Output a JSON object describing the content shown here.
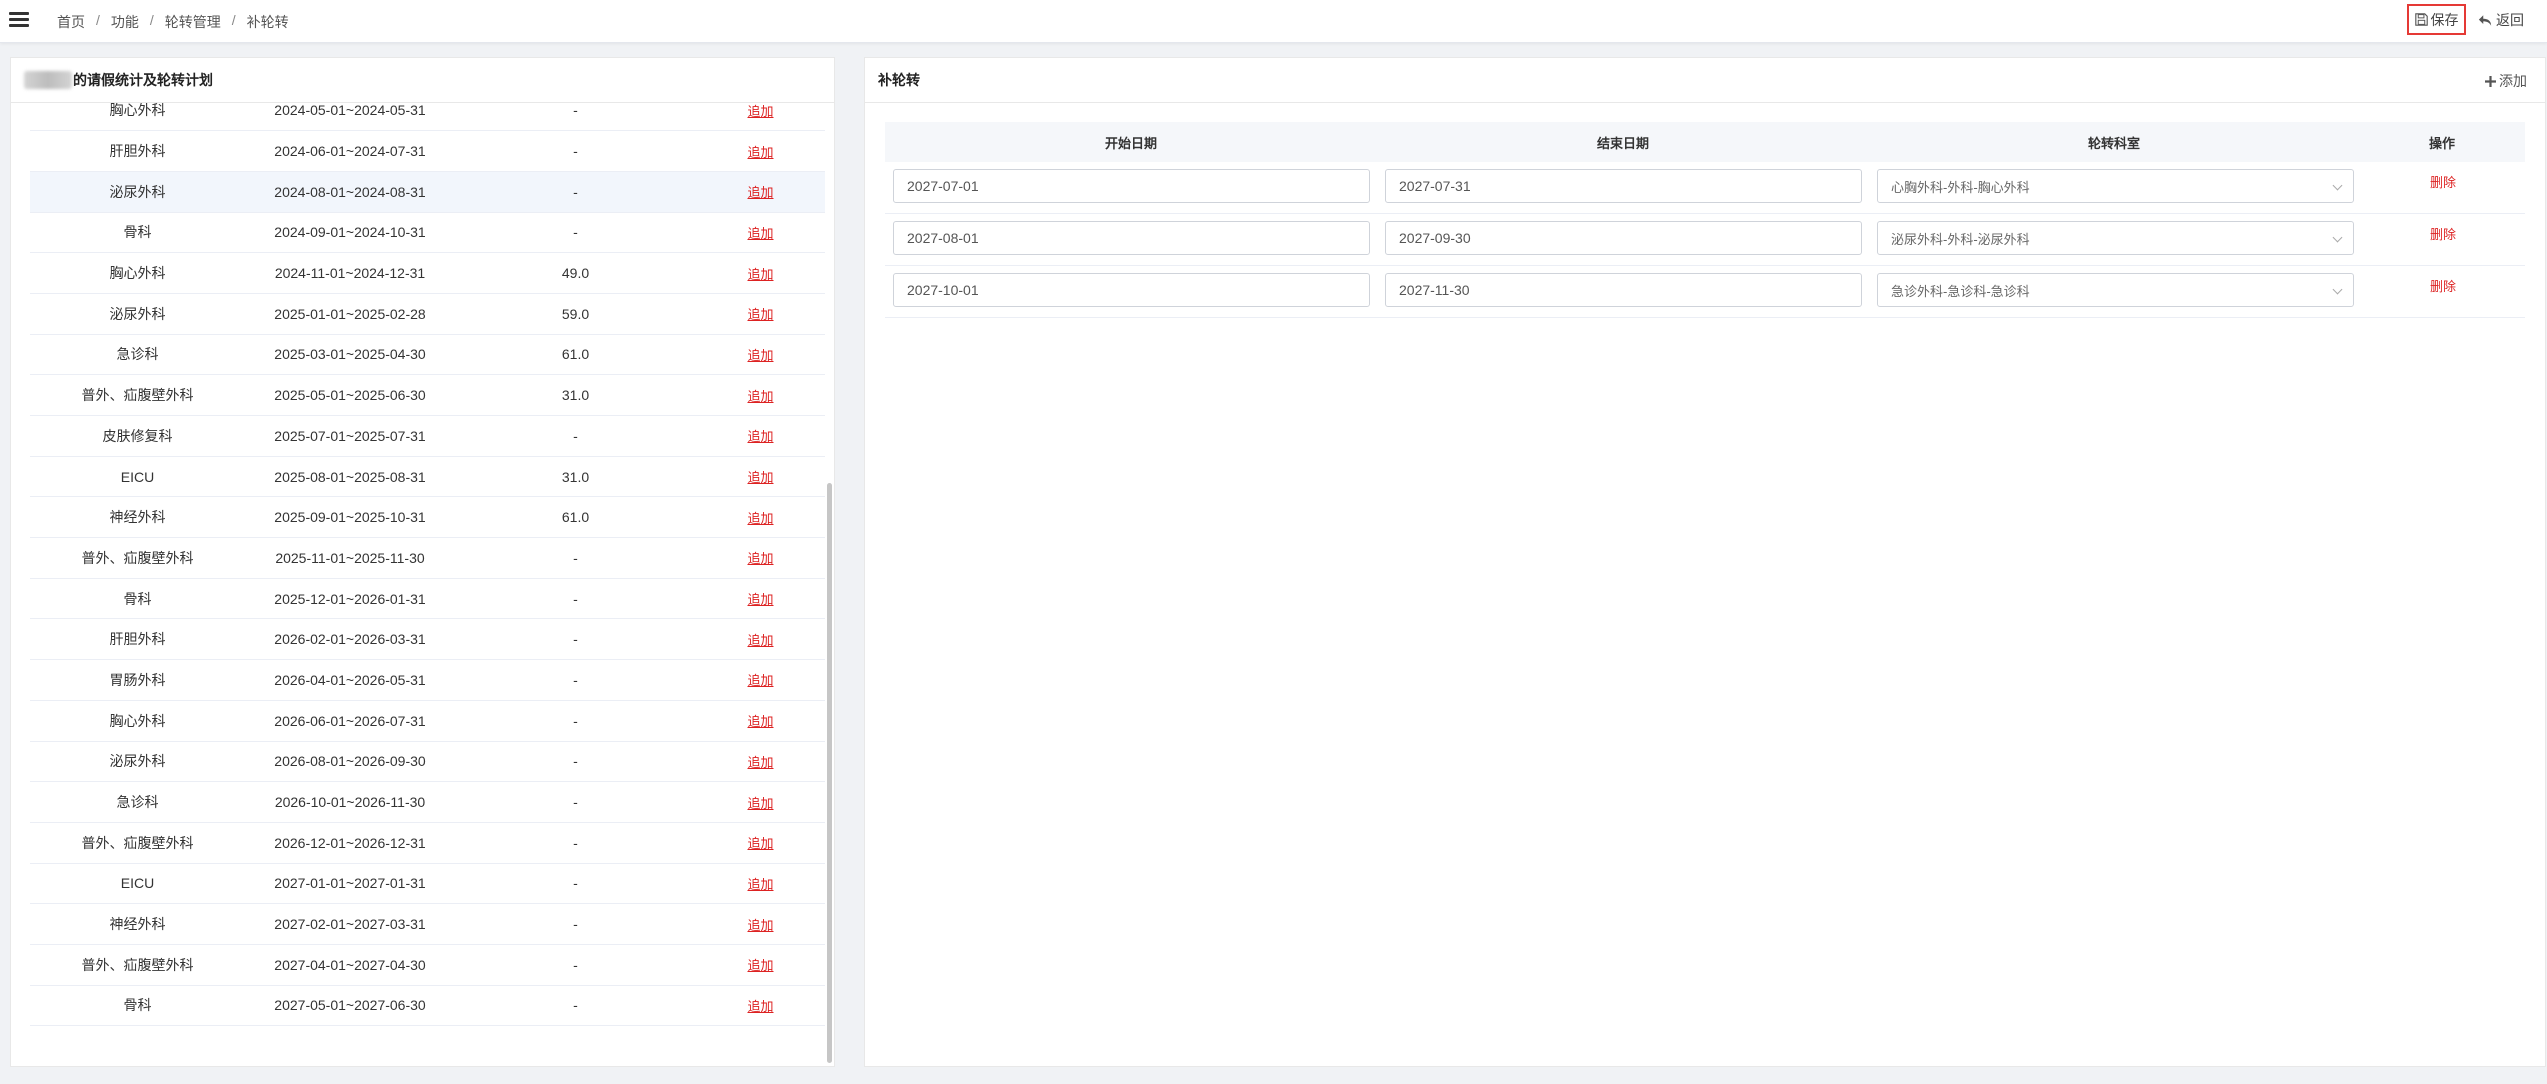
{
  "breadcrumb": [
    "首页",
    "功能",
    "轮转管理",
    "补轮转"
  ],
  "toolbar": {
    "save_label": "保存",
    "back_label": "返回"
  },
  "left_panel": {
    "title_suffix": "的请假统计及轮转计划",
    "add_link_label": "追加",
    "rows": [
      {
        "dept": "胸心外科",
        "period": "2024-05-01~2024-05-31",
        "days": "-"
      },
      {
        "dept": "肝胆外科",
        "period": "2024-06-01~2024-07-31",
        "days": "-"
      },
      {
        "dept": "泌尿外科",
        "period": "2024-08-01~2024-08-31",
        "days": "-",
        "highlighted": true
      },
      {
        "dept": "骨科",
        "period": "2024-09-01~2024-10-31",
        "days": "-"
      },
      {
        "dept": "胸心外科",
        "period": "2024-11-01~2024-12-31",
        "days": "49.0"
      },
      {
        "dept": "泌尿外科",
        "period": "2025-01-01~2025-02-28",
        "days": "59.0"
      },
      {
        "dept": "急诊科",
        "period": "2025-03-01~2025-04-30",
        "days": "61.0"
      },
      {
        "dept": "普外、疝腹壁外科",
        "period": "2025-05-01~2025-06-30",
        "days": "31.0"
      },
      {
        "dept": "皮肤修复科",
        "period": "2025-07-01~2025-07-31",
        "days": "-"
      },
      {
        "dept": "EICU",
        "period": "2025-08-01~2025-08-31",
        "days": "31.0"
      },
      {
        "dept": "神经外科",
        "period": "2025-09-01~2025-10-31",
        "days": "61.0"
      },
      {
        "dept": "普外、疝腹壁外科",
        "period": "2025-11-01~2025-11-30",
        "days": "-"
      },
      {
        "dept": "骨科",
        "period": "2025-12-01~2026-01-31",
        "days": "-"
      },
      {
        "dept": "肝胆外科",
        "period": "2026-02-01~2026-03-31",
        "days": "-"
      },
      {
        "dept": "胃肠外科",
        "period": "2026-04-01~2026-05-31",
        "days": "-"
      },
      {
        "dept": "胸心外科",
        "period": "2026-06-01~2026-07-31",
        "days": "-"
      },
      {
        "dept": "泌尿外科",
        "period": "2026-08-01~2026-09-30",
        "days": "-"
      },
      {
        "dept": "急诊科",
        "period": "2026-10-01~2026-11-30",
        "days": "-"
      },
      {
        "dept": "普外、疝腹壁外科",
        "period": "2026-12-01~2026-12-31",
        "days": "-"
      },
      {
        "dept": "EICU",
        "period": "2027-01-01~2027-01-31",
        "days": "-"
      },
      {
        "dept": "神经外科",
        "period": "2027-02-01~2027-03-31",
        "days": "-"
      },
      {
        "dept": "普外、疝腹壁外科",
        "period": "2027-04-01~2027-04-30",
        "days": "-"
      },
      {
        "dept": "骨科",
        "period": "2027-05-01~2027-06-30",
        "days": "-"
      }
    ]
  },
  "right_panel": {
    "title": "补轮转",
    "add_label": "添加",
    "columns": {
      "start": "开始日期",
      "end": "结束日期",
      "dept": "轮转科室",
      "op": "操作"
    },
    "delete_label": "删除",
    "rows": [
      {
        "start": "2027-07-01",
        "end": "2027-07-31",
        "dept": "心胸外科-外科-胸心外科"
      },
      {
        "start": "2027-08-01",
        "end": "2027-09-30",
        "dept": "泌尿外科-外科-泌尿外科"
      },
      {
        "start": "2027-10-01",
        "end": "2027-11-30",
        "dept": "急诊外科-急诊科-急诊科"
      }
    ]
  },
  "colors": {
    "accent_red": "#dd2222",
    "days_blue": "#3a6bc7",
    "highlight_row": "#f2f6fc"
  },
  "icons": {
    "menu": "hamburger-icon",
    "save": "floppy-icon",
    "back": "undo-arrow-icon",
    "add": "plus-icon",
    "select": "chevron-down-icon"
  }
}
